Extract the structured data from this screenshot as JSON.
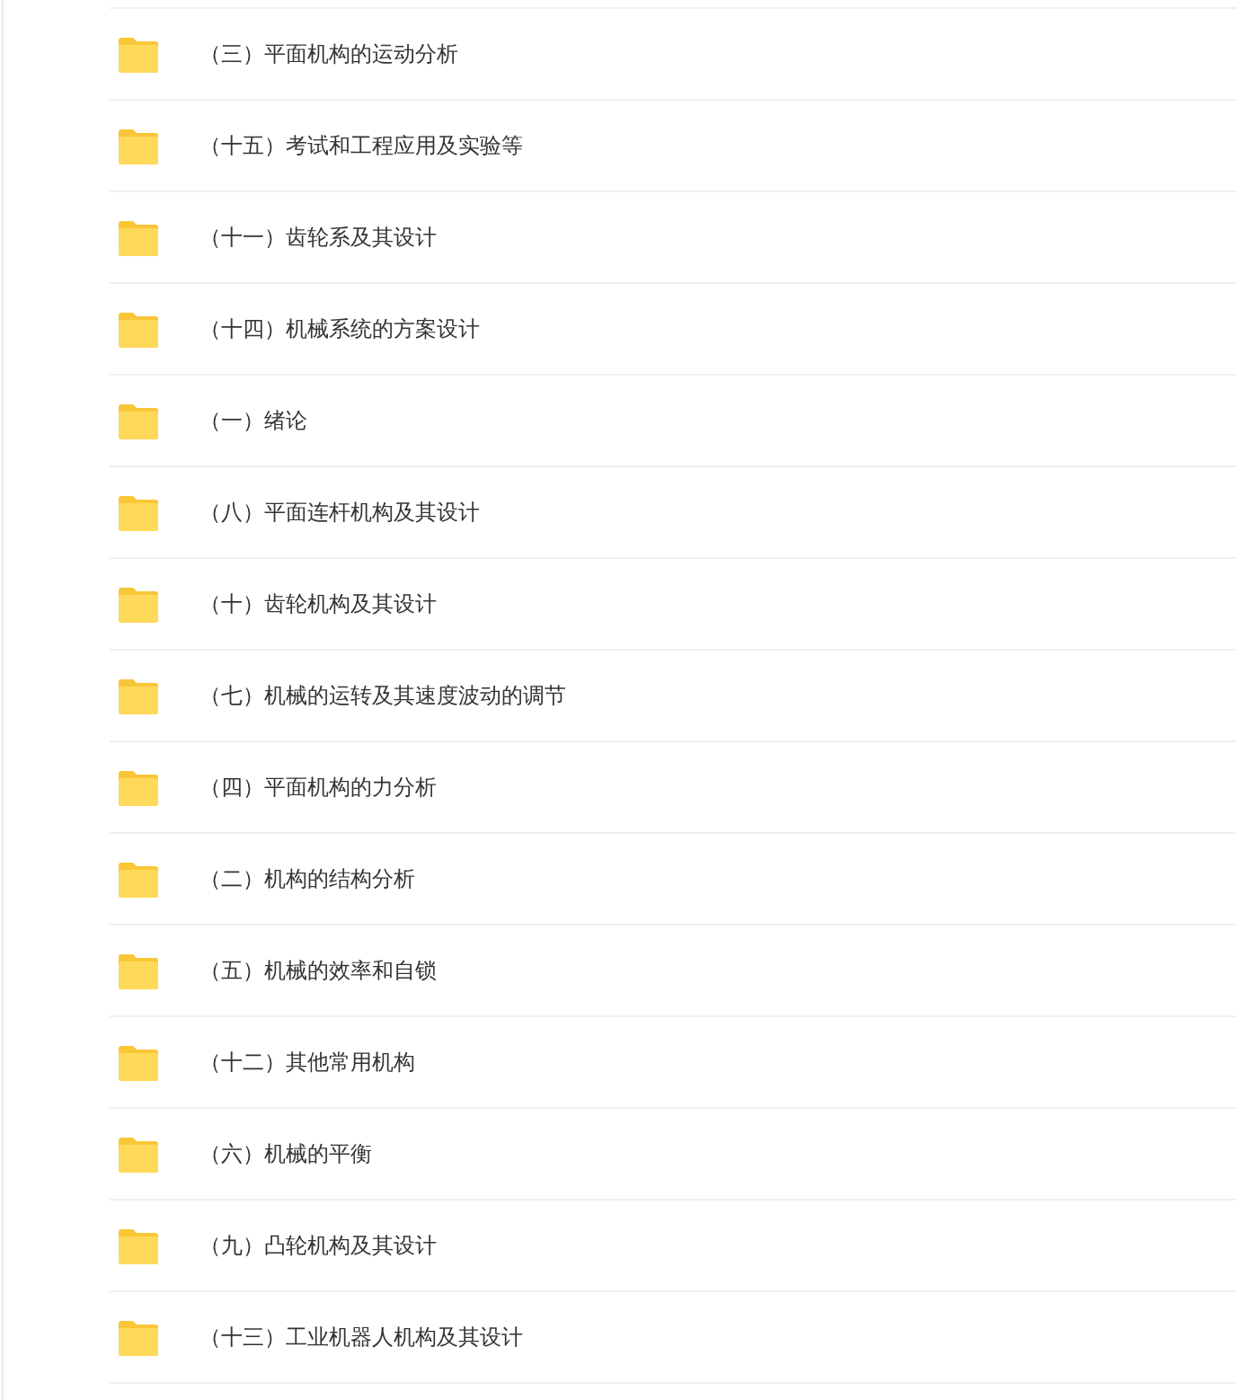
{
  "folders": [
    {
      "name": "（三）平面机构的运动分析"
    },
    {
      "name": "（十五）考试和工程应用及实验等"
    },
    {
      "name": "（十一）齿轮系及其设计"
    },
    {
      "name": "（十四）机械系统的方案设计"
    },
    {
      "name": "（一）绪论"
    },
    {
      "name": "（八）平面连杆机构及其设计"
    },
    {
      "name": "（十）齿轮机构及其设计"
    },
    {
      "name": "（七）机械的运转及其速度波动的调节"
    },
    {
      "name": "（四）平面机构的力分析"
    },
    {
      "name": "（二）机构的结构分析"
    },
    {
      "name": "（五）机械的效率和自锁"
    },
    {
      "name": "（十二）其他常用机构"
    },
    {
      "name": "（六）机械的平衡"
    },
    {
      "name": "（九）凸轮机构及其设计"
    },
    {
      "name": "（十三）工业机器人机构及其设计"
    }
  ]
}
